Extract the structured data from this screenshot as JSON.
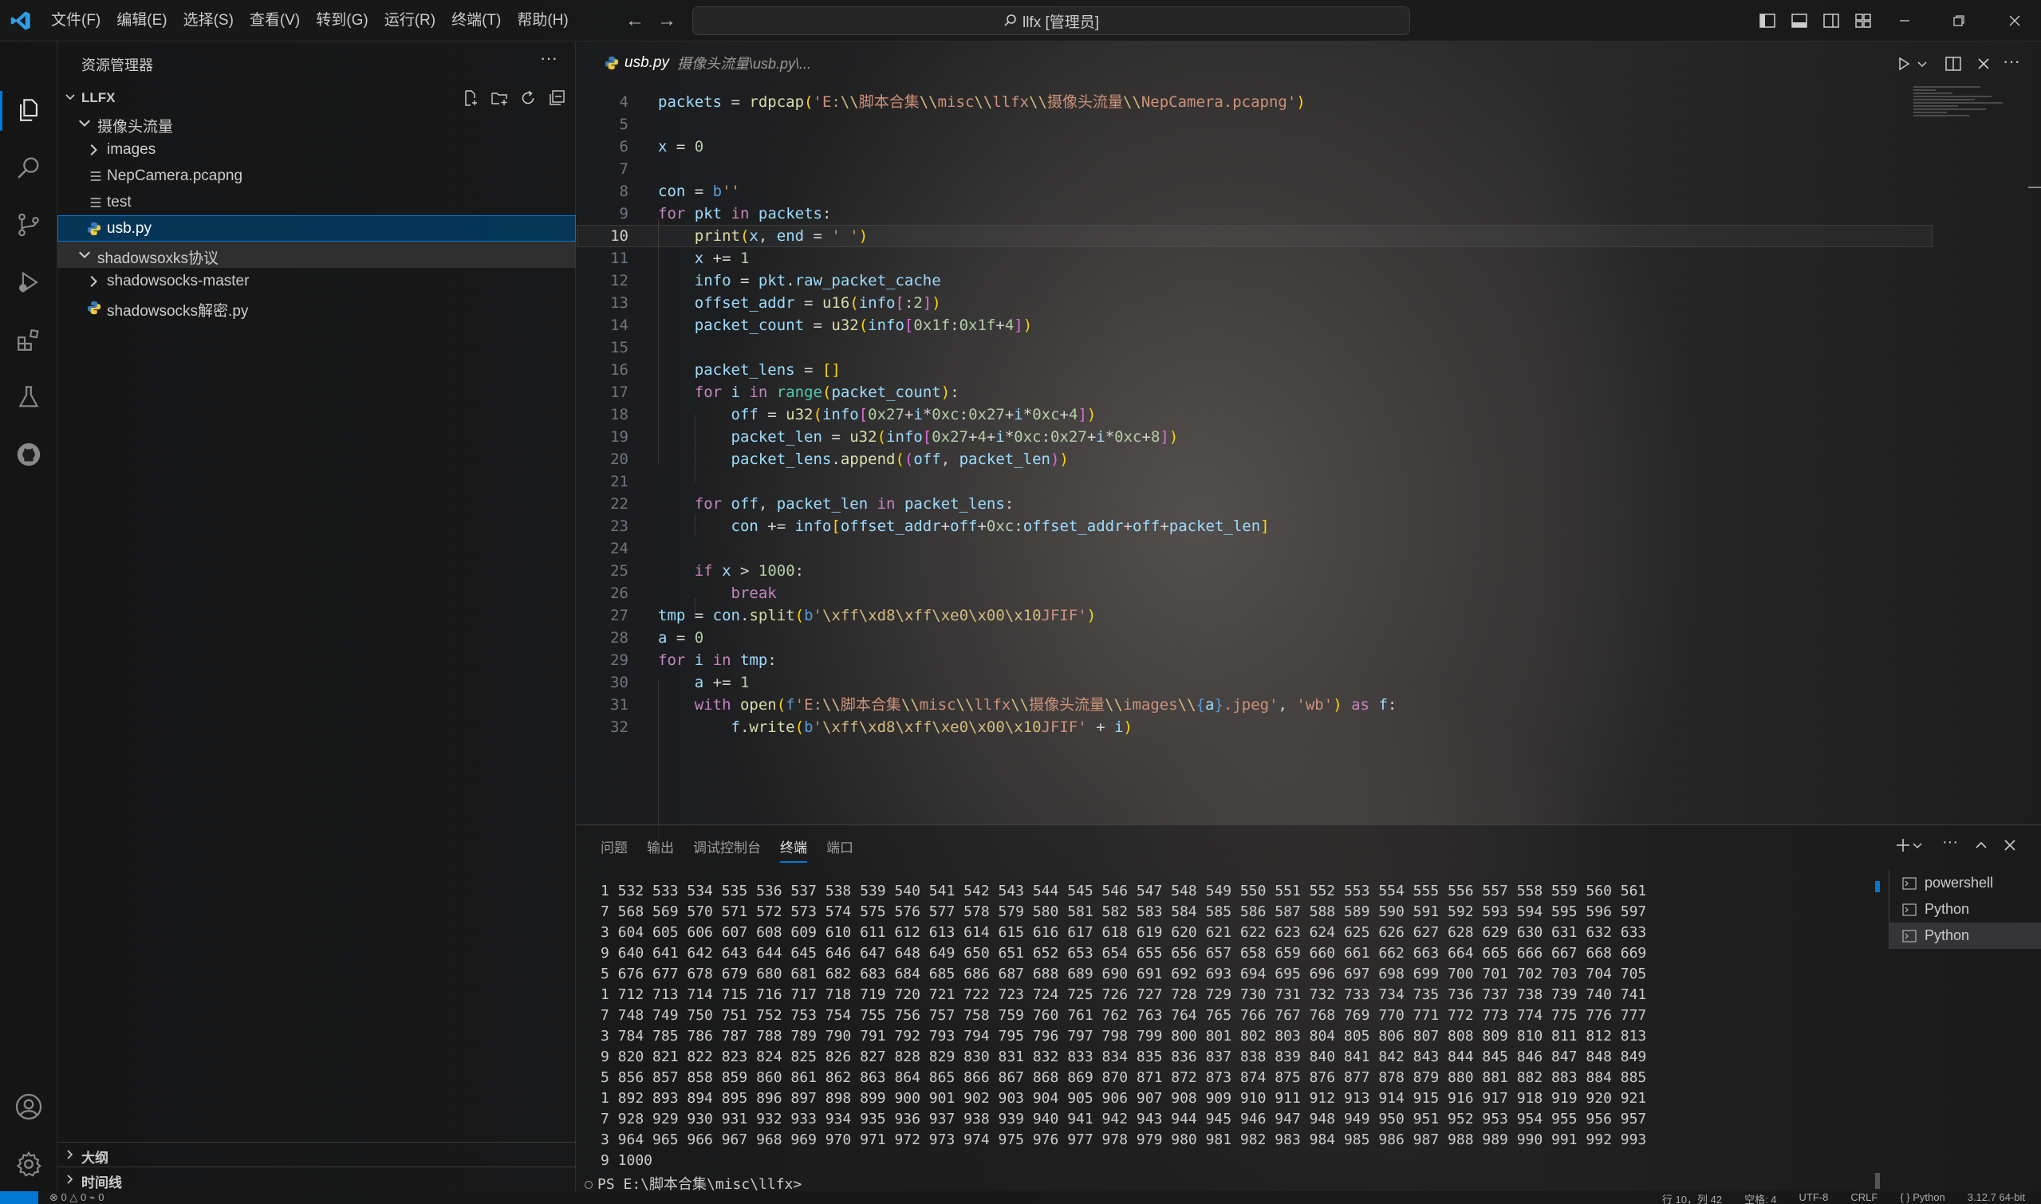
{
  "titlebar": {
    "menu": [
      "文件(F)",
      "编辑(E)",
      "选择(S)",
      "查看(V)",
      "转到(G)",
      "运行(R)",
      "终端(T)",
      "帮助(H)"
    ],
    "search": "llfx [管理员]"
  },
  "sidebar": {
    "title": "资源管理器",
    "folder": "LLFX",
    "tree": [
      {
        "label": "摄像头流量",
        "type": "folder-open"
      },
      {
        "label": "images",
        "type": "folder"
      },
      {
        "label": "NepCamera.pcapng",
        "type": "file"
      },
      {
        "label": "test",
        "type": "file"
      },
      {
        "label": "usb.py",
        "type": "python"
      },
      {
        "label": "shadowsoxks协议",
        "type": "folder-open"
      },
      {
        "label": "shadowsocks-master",
        "type": "folder"
      },
      {
        "label": "shadowsocks解密.py",
        "type": "python"
      }
    ],
    "outline": "大纲",
    "timeline": "时间线"
  },
  "editor": {
    "tab_name": "usb.py",
    "tab_desc": "摄像头流量\\usb.py\\...",
    "current_line": "10"
  },
  "panel": {
    "tabs": [
      "问题",
      "输出",
      "调试控制台",
      "终端",
      "端口"
    ],
    "active_tab": "终端",
    "terminals": [
      "powershell",
      "Python",
      "Python"
    ],
    "prompt": "PS E:\\脚本合集\\misc\\llfx>"
  },
  "statusbar": {
    "problems": "⊗ 0 △ 0   ⌁ 0",
    "right": [
      "行 10，列 42",
      "空格: 4",
      "UTF-8",
      "CRLF",
      "{ } Python",
      "3.12.7 64-bit"
    ]
  },
  "colors": {
    "accent": "#0078d4",
    "selection": "#04395e",
    "keyword": "#c586c0",
    "string": "#ce9178",
    "function": "#dcdcaa"
  }
}
